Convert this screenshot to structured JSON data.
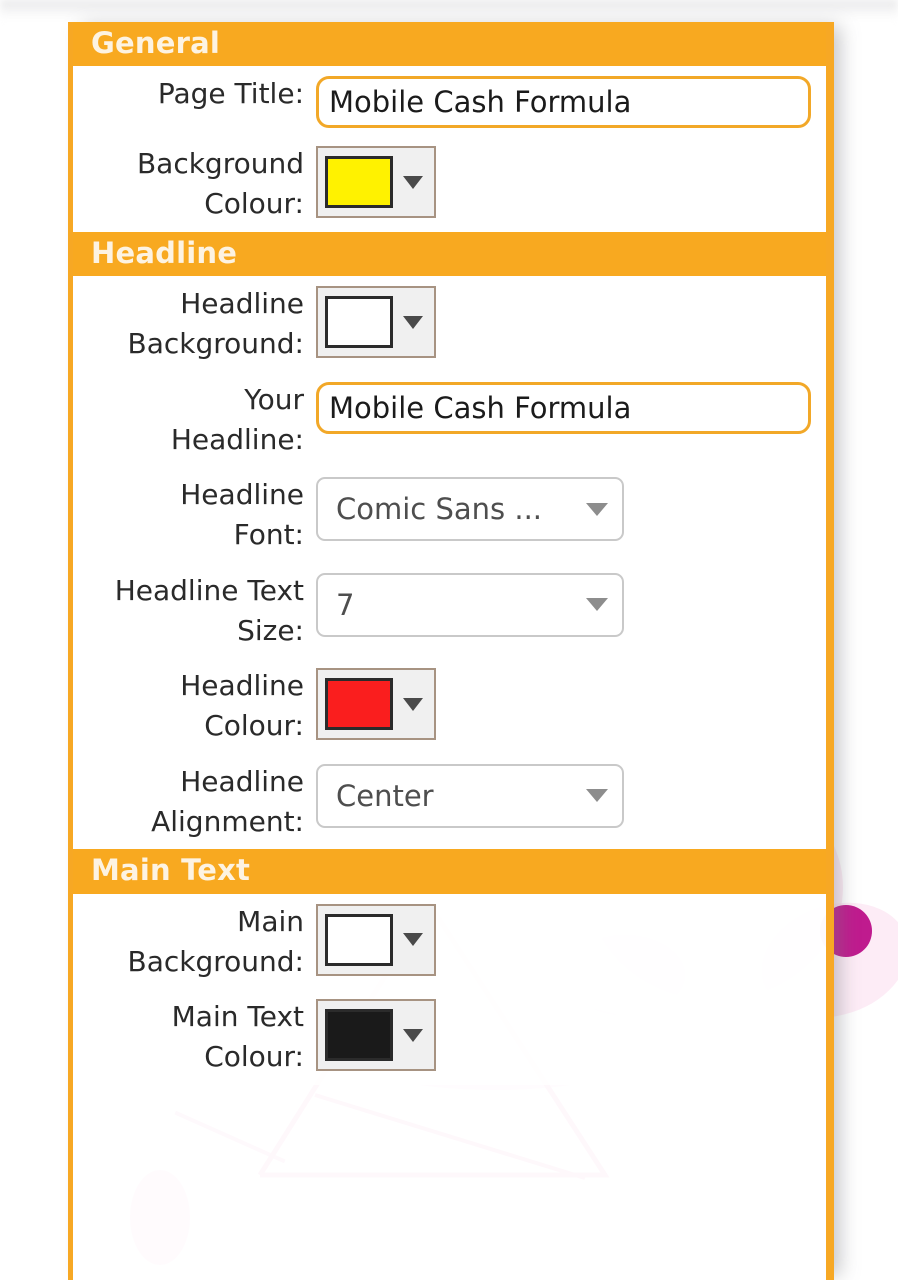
{
  "panel": {
    "sections": [
      {
        "id": "general",
        "title": "General",
        "rows": [
          {
            "label": "Page Title:",
            "control": "text",
            "value": "Mobile Cash Formula",
            "name": "page-title"
          },
          {
            "label": "Background\nColour:",
            "control": "color",
            "value": "#fff200",
            "name": "background-colour"
          }
        ]
      },
      {
        "id": "headline",
        "title": "Headline",
        "rows": [
          {
            "label": "Headline\nBackground:",
            "control": "color",
            "value": "#ffffff",
            "name": "headline-background"
          },
          {
            "label": "Your\nHeadline:",
            "control": "text",
            "value": "Mobile Cash Formula",
            "name": "your-headline"
          },
          {
            "label": "Headline\nFont:",
            "control": "select",
            "value": "Comic Sans ...",
            "name": "headline-font"
          },
          {
            "label": "Headline Text\nSize:",
            "control": "select",
            "value": "7",
            "name": "headline-text-size"
          },
          {
            "label": "Headline\nColour:",
            "control": "color",
            "value": "#fa1e1e",
            "name": "headline-colour"
          },
          {
            "label": "Headline\nAlignment:",
            "control": "select",
            "value": "Center",
            "name": "headline-alignment"
          }
        ]
      },
      {
        "id": "main-text",
        "title": "Main Text",
        "rows": [
          {
            "label": "Main\nBackground:",
            "control": "color",
            "value": "#ffffff",
            "name": "main-background"
          },
          {
            "label": "Main Text\nColour:",
            "control": "color",
            "value": "#1a1a1a",
            "name": "main-text-colour"
          }
        ]
      }
    ]
  },
  "theme": {
    "accent_orange": "#f8a920",
    "header_text": "#fdf3e2",
    "input_border": "#f2a828",
    "decor_pink": "#fbdcee",
    "decor_magenta": "#bf1b8e"
  }
}
